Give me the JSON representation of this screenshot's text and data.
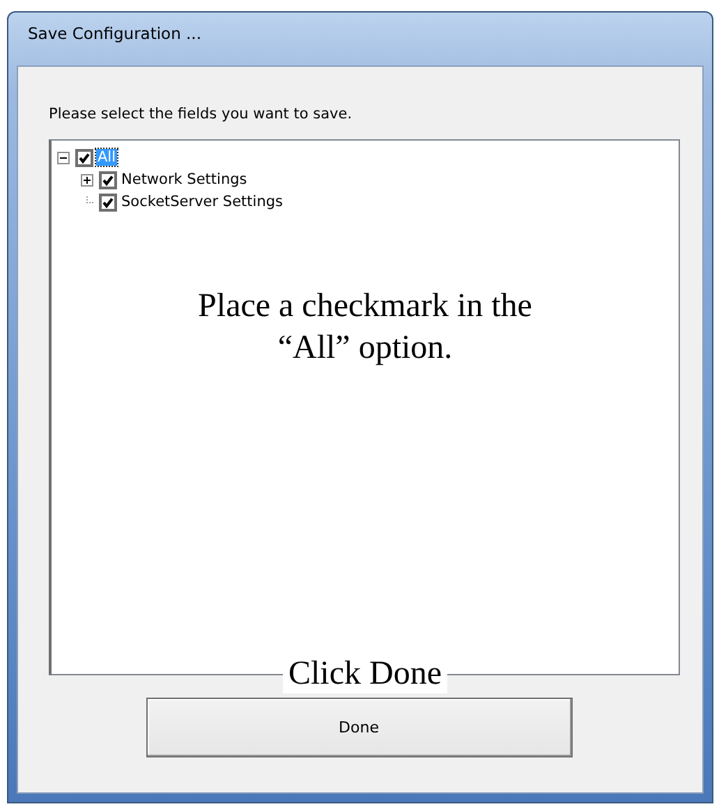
{
  "window": {
    "title": "Save Configuration ..."
  },
  "instruction": "Please select the fields you want to save.",
  "tree": [
    {
      "label": "All",
      "checked": true,
      "selected": true,
      "expanded": true,
      "children": [
        {
          "label": "Network Settings",
          "checked": true,
          "selected": false,
          "expanded": false
        },
        {
          "label": "SocketServer Settings",
          "checked": true,
          "selected": false
        }
      ]
    }
  ],
  "annotations": [
    "Place a checkmark in the “All” option.",
    "Click Done"
  ],
  "buttons": [
    "Done"
  ]
}
